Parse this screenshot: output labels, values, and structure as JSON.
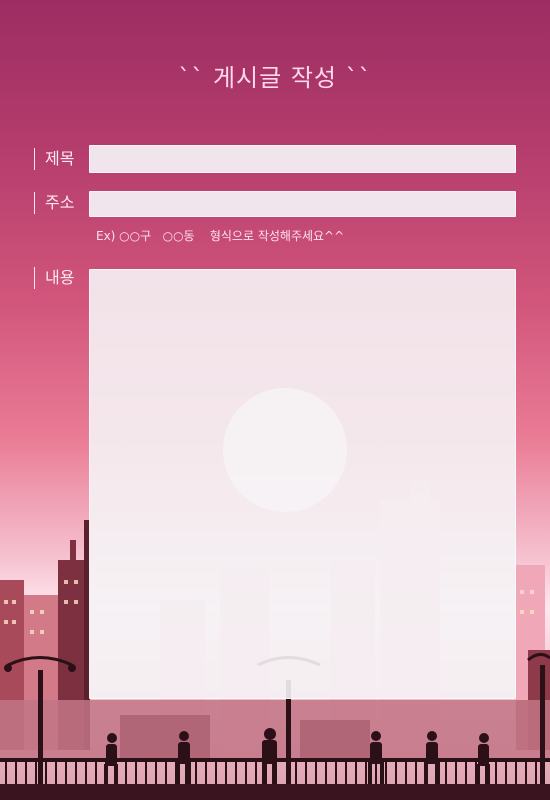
{
  "page": {
    "title": "`` 게시글 작성 ``"
  },
  "form": {
    "subject_label": "제목",
    "subject_value": "",
    "address_label": "주소",
    "address_value": "",
    "address_hint": "Ex) ○○구   ○○동    형식으로 작성해주세요^^",
    "content_label": "내용",
    "content_value": ""
  },
  "colors": {
    "sky_top": "#9c2d63",
    "sky_mid": "#ea7c96",
    "sun": "#fff2f4",
    "silhouette": "#3a1520"
  }
}
